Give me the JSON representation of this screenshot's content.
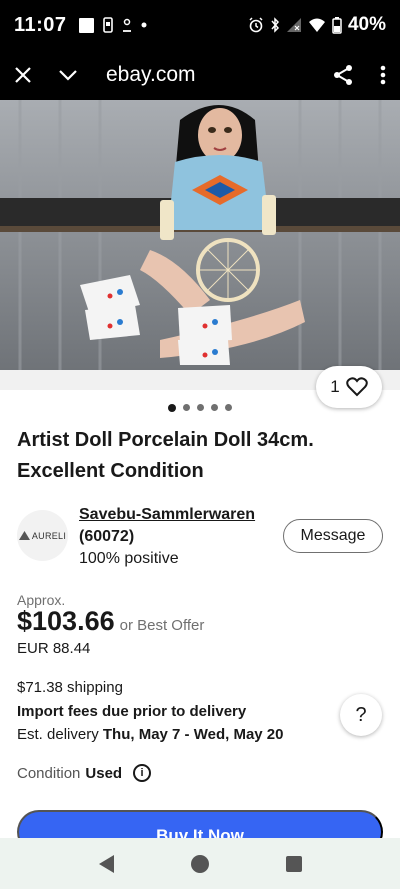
{
  "status_bar": {
    "time": "11:07",
    "battery": "40%",
    "icons": [
      "square-icon",
      "phone-icon",
      "person-icon",
      "dot-icon",
      "alarm-icon",
      "bluetooth-icon",
      "signal-icon",
      "wifi-icon",
      "battery-icon"
    ]
  },
  "browser": {
    "url": "ebay.com",
    "icons": [
      "close-icon",
      "chevron-down-icon",
      "share-icon",
      "more-vertical-icon"
    ]
  },
  "gallery": {
    "watch_count": "1",
    "image_count": 5,
    "active_index": 0
  },
  "listing": {
    "title": "Artist Doll Porcelain Doll 34cm. Excellent Condition"
  },
  "seller": {
    "avatar_text": "AURELI",
    "name": "Savebu-Sammlerwaren",
    "score": "(60072)",
    "positive": "100% positive",
    "message_label": "Message"
  },
  "price": {
    "approx_label": "Approx.",
    "amount": "$103.66",
    "best_offer": "or Best Offer",
    "original": "EUR 88.44"
  },
  "shipping": {
    "cost": "$71.38 shipping",
    "import_fees": "Import fees due prior to delivery",
    "delivery_label": "Est. delivery",
    "delivery_dates": "Thu, May 7 - Wed, May 20",
    "help_label": "?"
  },
  "condition": {
    "label": "Condition",
    "value": "Used",
    "info_label": "i"
  },
  "actions": {
    "buy_now": "Buy It Now"
  },
  "colors": {
    "accent": "#3665f3",
    "text": "#191919",
    "muted": "#707070"
  }
}
